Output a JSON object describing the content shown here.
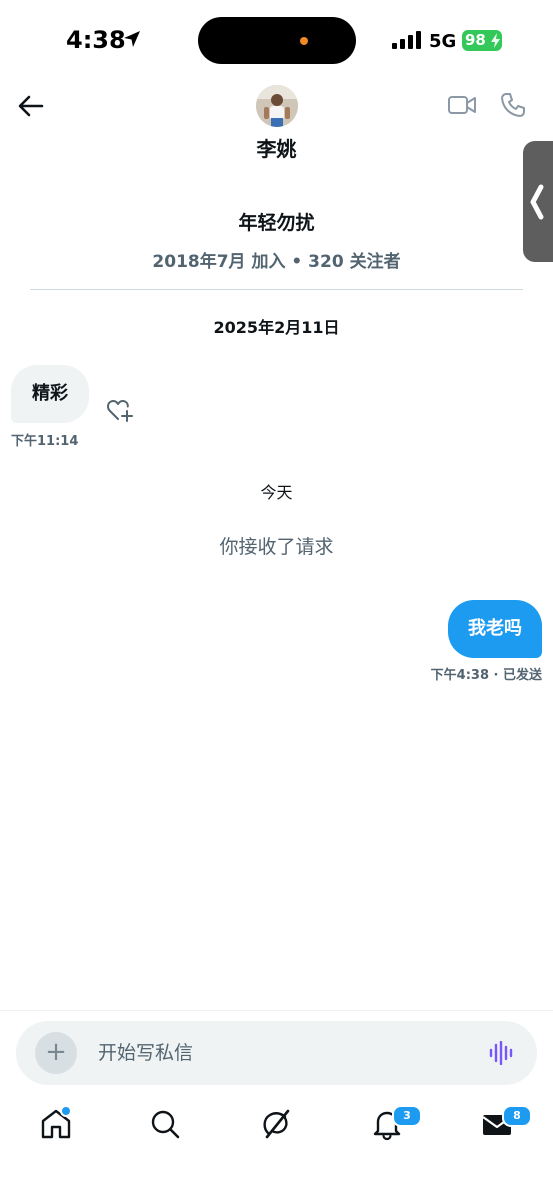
{
  "status_bar": {
    "time": "4:38",
    "network": "5G",
    "battery": "98"
  },
  "header": {
    "name": "李姚"
  },
  "profile": {
    "bio": "年轻勿扰",
    "meta": "2018年7月 加入 • 320 关注者"
  },
  "conversation": {
    "date_separator": "2025年2月11日",
    "received": {
      "text": "精彩",
      "time": "下午11:14"
    },
    "today_label": "今天",
    "system_message": "你接收了请求",
    "sent": {
      "text": "我老吗",
      "time": "下午4:38 · 已发送"
    }
  },
  "composer": {
    "placeholder": "开始写私信"
  },
  "tab_bar": {
    "notifications_badge": "3",
    "messages_badge": "8"
  },
  "colors": {
    "accent": "#1d9bf0",
    "secondary_text": "#536471",
    "battery": "#34c759"
  }
}
